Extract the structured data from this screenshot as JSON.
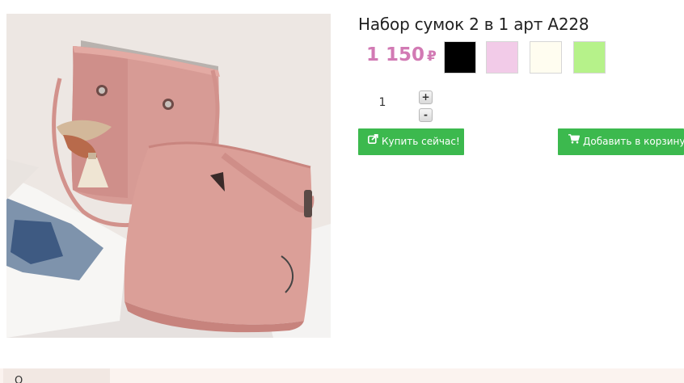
{
  "product": {
    "title": "Набор сумок 2 в 1 арт A228",
    "price": "1 150",
    "currency": "₽",
    "image_alt": "pink-bag-set-photo"
  },
  "swatches": [
    {
      "name": "black",
      "color": "#000000"
    },
    {
      "name": "pink",
      "color": "#f2cbe8"
    },
    {
      "name": "ivory",
      "color": "#fffdf0"
    },
    {
      "name": "light-green",
      "color": "#b6f28a"
    }
  ],
  "quantity": {
    "value": "1",
    "plus_label": "+",
    "minus_label": "-"
  },
  "actions": {
    "buy_now_label": "Купить сейчас!",
    "add_to_cart_label": "Добавить в корзину"
  },
  "tabs": {
    "first_label": "О"
  },
  "colors": {
    "accent_green": "#3cb94e",
    "price_pink": "#d27ab4"
  }
}
